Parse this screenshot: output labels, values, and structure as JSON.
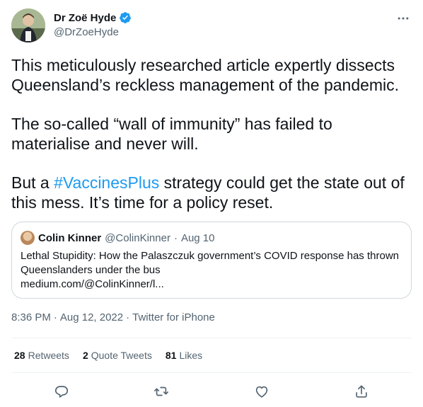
{
  "author": {
    "name": "Dr Zoë Hyde",
    "handle": "@DrZoeHyde"
  },
  "tweet": {
    "paragraph1": "This meticulously researched article expertly dissects Queensland’s reckless management of the pandemic.",
    "paragraph2": "The so-called “wall of immunity” has failed to materialise and never will.",
    "paragraph3_before": "But a ",
    "hashtag": "#VaccinesPlus",
    "paragraph3_after": " strategy could get the state out of this mess. It’s time for a policy reset."
  },
  "quote": {
    "name": "Colin Kinner",
    "handle": "@ColinKinner",
    "separator": "·",
    "date": "Aug 10",
    "text": "Lethal Stupidity: How the Palaszczuk government’s COVID response has thrown Queenslanders under the bus",
    "link": "medium.com/@ColinKinner/l..."
  },
  "meta": {
    "time": "8:36 PM",
    "sep1": "·",
    "date": "Aug 12, 2022",
    "sep2": "·",
    "source": "Twitter for iPhone"
  },
  "stats": {
    "retweets": {
      "count": "28",
      "label": "Retweets"
    },
    "quotes": {
      "count": "2",
      "label": "Quote Tweets"
    },
    "likes": {
      "count": "81",
      "label": "Likes"
    }
  },
  "colors": {
    "accent": "#1d9bf0",
    "secondary_text": "#536471",
    "border": "#cfd9de"
  },
  "icons": {
    "more": "more-horizontal-icon",
    "verified": "verified-badge-icon",
    "reply": "reply-icon",
    "retweet": "retweet-icon",
    "like": "heart-icon",
    "share": "share-icon"
  }
}
